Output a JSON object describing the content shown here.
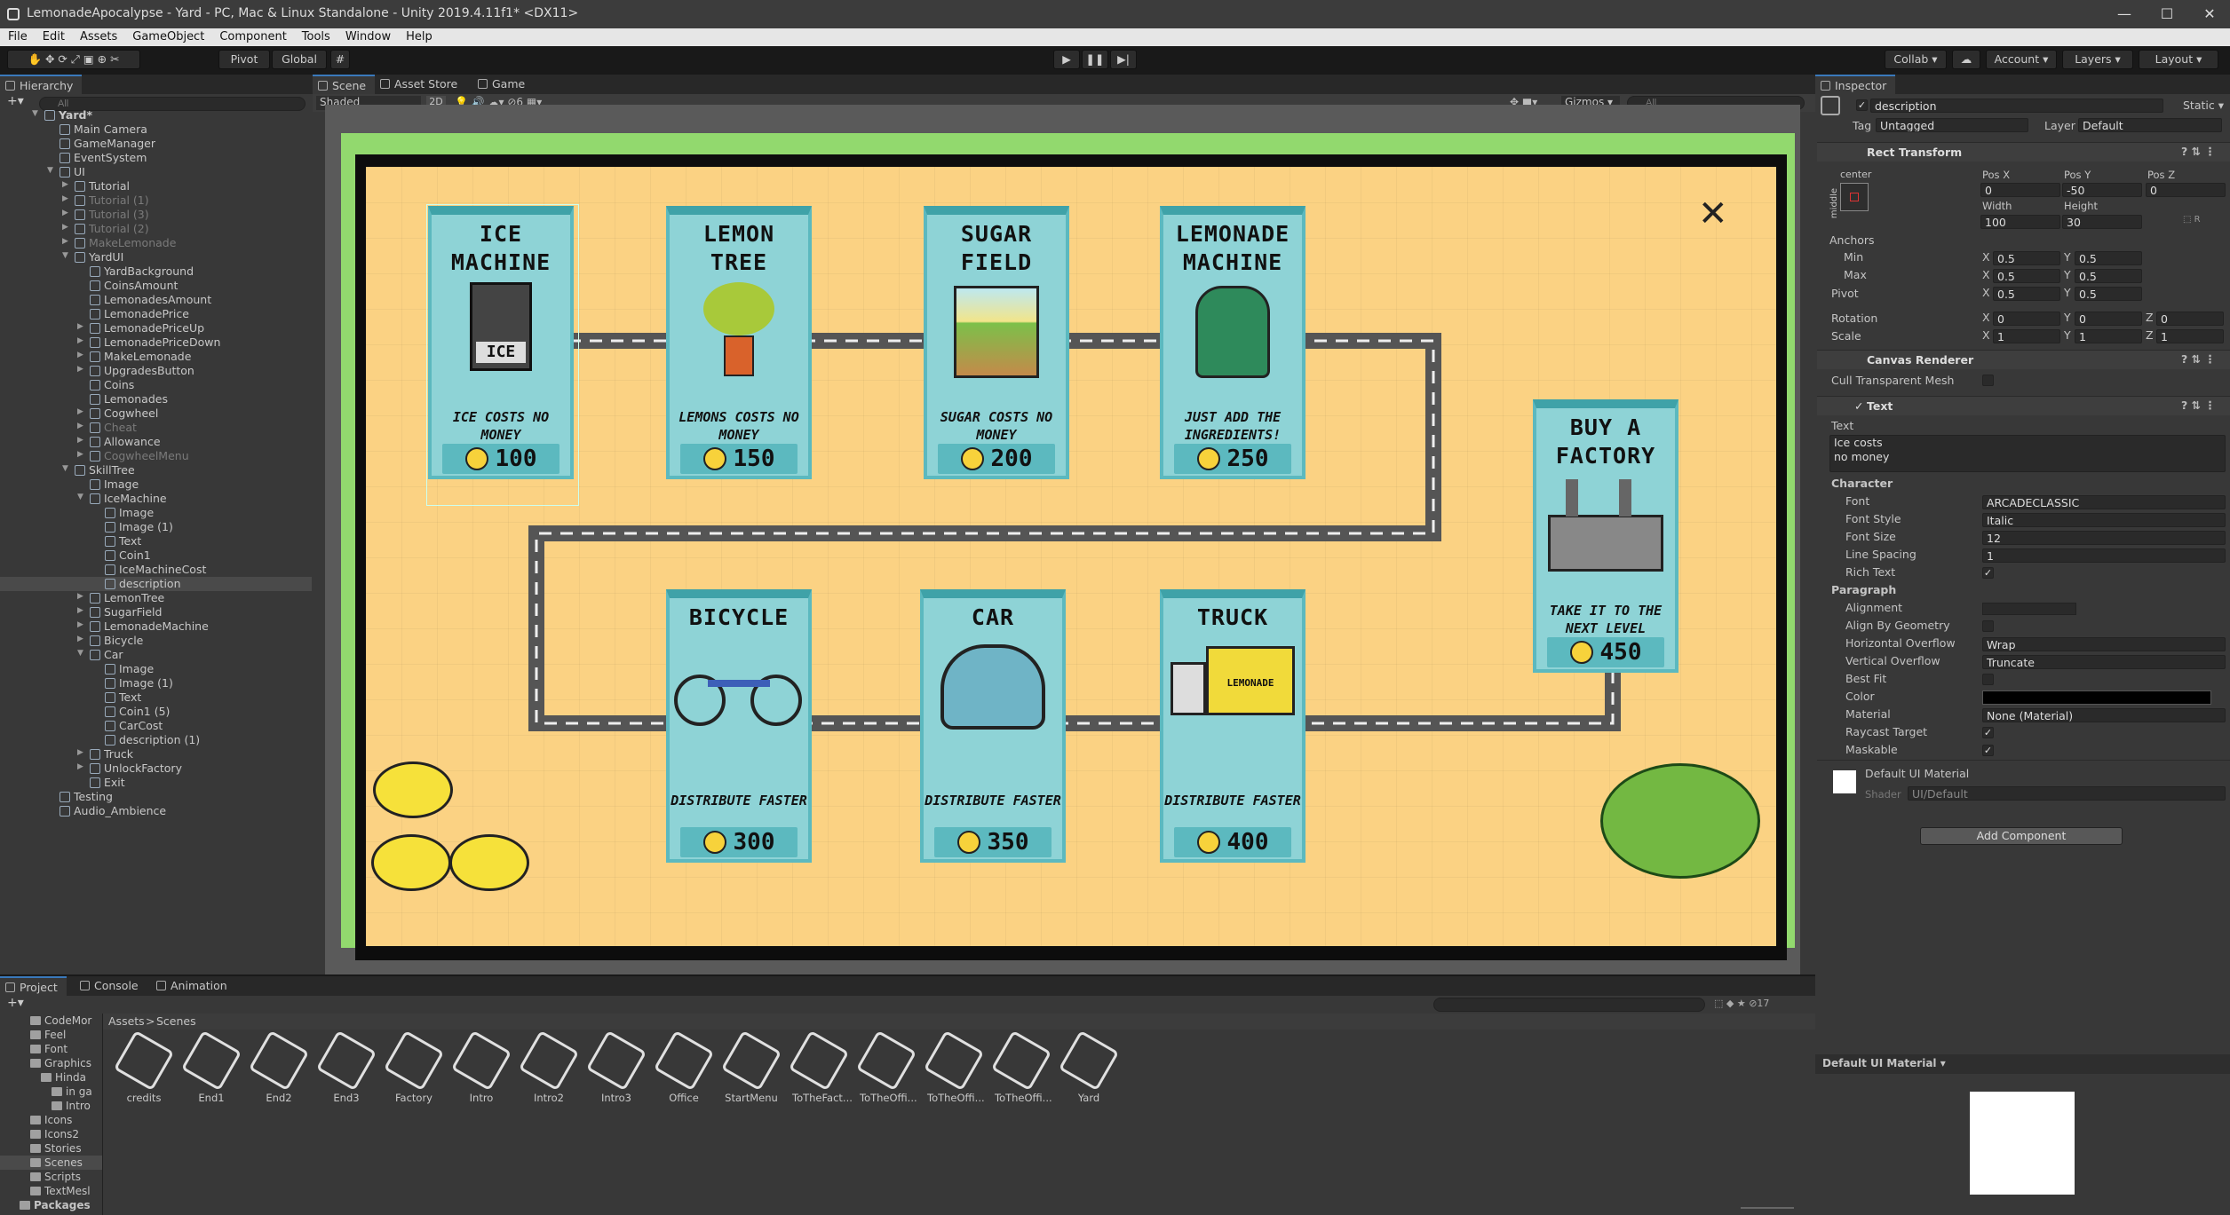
{
  "window": {
    "title": "LemonadeApocalypse - Yard - PC, Mac & Linux Standalone - Unity 2019.4.11f1* <DX11>"
  },
  "menu": [
    "File",
    "Edit",
    "Assets",
    "GameObject",
    "Component",
    "Tools",
    "Window",
    "Help"
  ],
  "toolbar": {
    "pivot": "Pivot",
    "global": "Global",
    "collab": "Collab ▾",
    "account": "Account ▾",
    "layers": "Layers ▾",
    "layout": "Layout ▾"
  },
  "hierarchy": {
    "title": "Hierarchy",
    "search_placeholder": "All",
    "rows": [
      {
        "label": "Yard*",
        "depth": 0,
        "arrow": "▼",
        "bold": true
      },
      {
        "label": "Main Camera",
        "depth": 1,
        "arrow": ""
      },
      {
        "label": "GameManager",
        "depth": 1,
        "arrow": ""
      },
      {
        "label": "EventSystem",
        "depth": 1,
        "arrow": ""
      },
      {
        "label": "UI",
        "depth": 1,
        "arrow": "▼"
      },
      {
        "label": "Tutorial",
        "depth": 2,
        "arrow": "▶"
      },
      {
        "label": "Tutorial (1)",
        "depth": 2,
        "arrow": "▶",
        "dim": true
      },
      {
        "label": "Tutorial (3)",
        "depth": 2,
        "arrow": "▶",
        "dim": true
      },
      {
        "label": "Tutorial (2)",
        "depth": 2,
        "arrow": "▶",
        "dim": true
      },
      {
        "label": "MakeLemonade",
        "depth": 2,
        "arrow": "▶",
        "dim": true
      },
      {
        "label": "YardUI",
        "depth": 2,
        "arrow": "▼"
      },
      {
        "label": "YardBackground",
        "depth": 3,
        "arrow": ""
      },
      {
        "label": "CoinsAmount",
        "depth": 3,
        "arrow": ""
      },
      {
        "label": "LemonadesAmount",
        "depth": 3,
        "arrow": ""
      },
      {
        "label": "LemonadePrice",
        "depth": 3,
        "arrow": ""
      },
      {
        "label": "LemonadePriceUp",
        "depth": 3,
        "arrow": "▶"
      },
      {
        "label": "LemonadePriceDown",
        "depth": 3,
        "arrow": "▶"
      },
      {
        "label": "MakeLemonade",
        "depth": 3,
        "arrow": "▶"
      },
      {
        "label": "UpgradesButton",
        "depth": 3,
        "arrow": "▶"
      },
      {
        "label": "Coins",
        "depth": 3,
        "arrow": ""
      },
      {
        "label": "Lemonades",
        "depth": 3,
        "arrow": ""
      },
      {
        "label": "Cogwheel",
        "depth": 3,
        "arrow": "▶"
      },
      {
        "label": "Cheat",
        "depth": 3,
        "arrow": "▶",
        "dim": true
      },
      {
        "label": "Allowance",
        "depth": 3,
        "arrow": "▶"
      },
      {
        "label": "CogwheelMenu",
        "depth": 3,
        "arrow": "▶",
        "dim": true
      },
      {
        "label": "SkillTree",
        "depth": 2,
        "arrow": "▼"
      },
      {
        "label": "Image",
        "depth": 3,
        "arrow": ""
      },
      {
        "label": "IceMachine",
        "depth": 3,
        "arrow": "▼"
      },
      {
        "label": "Image",
        "depth": 4,
        "arrow": ""
      },
      {
        "label": "Image (1)",
        "depth": 4,
        "arrow": ""
      },
      {
        "label": "Text",
        "depth": 4,
        "arrow": ""
      },
      {
        "label": "Coin1",
        "depth": 4,
        "arrow": ""
      },
      {
        "label": "IceMachineCost",
        "depth": 4,
        "arrow": ""
      },
      {
        "label": "description",
        "depth": 4,
        "arrow": "",
        "selected": true
      },
      {
        "label": "LemonTree",
        "depth": 3,
        "arrow": "▶"
      },
      {
        "label": "SugarField",
        "depth": 3,
        "arrow": "▶"
      },
      {
        "label": "LemonadeMachine",
        "depth": 3,
        "arrow": "▶"
      },
      {
        "label": "Bicycle",
        "depth": 3,
        "arrow": "▶"
      },
      {
        "label": "Car",
        "depth": 3,
        "arrow": "▼"
      },
      {
        "label": "Image",
        "depth": 4,
        "arrow": ""
      },
      {
        "label": "Image (1)",
        "depth": 4,
        "arrow": ""
      },
      {
        "label": "Text",
        "depth": 4,
        "arrow": ""
      },
      {
        "label": "Coin1 (5)",
        "depth": 4,
        "arrow": ""
      },
      {
        "label": "CarCost",
        "depth": 4,
        "arrow": ""
      },
      {
        "label": "description (1)",
        "depth": 4,
        "arrow": ""
      },
      {
        "label": "Truck",
        "depth": 3,
        "arrow": "▶"
      },
      {
        "label": "UnlockFactory",
        "depth": 3,
        "arrow": "▶"
      },
      {
        "label": "Exit",
        "depth": 3,
        "arrow": ""
      },
      {
        "label": "Testing",
        "depth": 1,
        "arrow": ""
      },
      {
        "label": "Audio_Ambience",
        "depth": 1,
        "arrow": ""
      }
    ]
  },
  "scene_tabs": [
    "Scene",
    "Asset Store",
    "Game"
  ],
  "scene_toolbar": {
    "shading": "Shaded",
    "mode2d": "2D",
    "gizmos": "Gizmos ▾",
    "search": "All",
    "hidden": "6"
  },
  "game": {
    "close": "✕",
    "cards": [
      {
        "title": "ICE MACHINE",
        "desc": "ICE COSTS NO MONEY",
        "price": "100"
      },
      {
        "title": "LEMON TREE",
        "desc": "LEMONS COSTS NO MONEY",
        "price": "150"
      },
      {
        "title": "SUGAR FIELD",
        "desc": "SUGAR COSTS NO MONEY",
        "price": "200"
      },
      {
        "title": "LEMONADE MACHINE",
        "desc": "JUST ADD THE INGREDIENTS!",
        "price": "250"
      },
      {
        "title": "BUY A FACTORY",
        "desc": "TAKE IT TO THE NEXT LEVEL",
        "price": "450"
      },
      {
        "title": "BICYCLE",
        "desc": "DISTRIBUTE FASTER",
        "price": "300"
      },
      {
        "title": "CAR",
        "desc": "DISTRIBUTE FASTER",
        "price": "350"
      },
      {
        "title": "TRUCK",
        "desc": "DISTRIBUTE FASTER",
        "price": "400"
      }
    ],
    "ice_label": "ICE",
    "truck_label": "LEMONADE"
  },
  "inspector": {
    "title": "Inspector",
    "object_name": "description",
    "static": "Static ▾",
    "tag_label": "Tag",
    "tag": "Untagged",
    "layer_label": "Layer",
    "layer": "Default",
    "rect": {
      "title": "Rect Transform",
      "anchor_label": "center",
      "side_label": "middle",
      "posx_label": "Pos X",
      "posy_label": "Pos Y",
      "posz_label": "Pos Z",
      "posx": "0",
      "posy": "-50",
      "posz": "0",
      "w_label": "Width",
      "h_label": "Height",
      "w": "100",
      "h": "30",
      "anchors": "Anchors",
      "min": "Min",
      "max": "Max",
      "pivot": "Pivot",
      "rotation": "Rotation",
      "scale": "Scale",
      "x": "X",
      "y": "Y",
      "z": "Z",
      "v05": "0.5",
      "v0": "0",
      "v1": "1"
    },
    "canvas_renderer": "Canvas Renderer",
    "cull": "Cull Transparent Mesh",
    "text": {
      "title": "Text",
      "text_label": "Text",
      "text_value1": "Ice costs",
      "text_value2": "no money",
      "character": "Character",
      "font_label": "Font",
      "font": "ARCADECLASSIC",
      "style_label": "Font Style",
      "style": "Italic",
      "size_label": "Font Size",
      "size": "12",
      "spacing_label": "Line Spacing",
      "spacing": "1",
      "rich_label": "Rich Text",
      "paragraph": "Paragraph",
      "align_label": "Alignment",
      "geom_label": "Align By Geometry",
      "hover_label": "Horizontal Overflow",
      "hover": "Wrap",
      "vover_label": "Vertical Overflow",
      "vover": "Truncate",
      "best_label": "Best Fit",
      "color_label": "Color",
      "material_label": "Material",
      "material": "None (Material)",
      "raycast_label": "Raycast Target",
      "maskable_label": "Maskable"
    },
    "material": {
      "name": "Default UI Material",
      "shader_label": "Shader",
      "shader": "UI/Default"
    },
    "add_component": "Add Component",
    "preview_label": "Default UI Material ▾"
  },
  "project": {
    "tabs": [
      "Project",
      "Console",
      "Animation"
    ],
    "breadcrumb": [
      "Assets",
      ">",
      "Scenes"
    ],
    "count": "17",
    "tree": [
      {
        "label": "CodeMor",
        "depth": 1
      },
      {
        "label": "Feel",
        "depth": 1
      },
      {
        "label": "Font",
        "depth": 1
      },
      {
        "label": "Graphics",
        "depth": 1
      },
      {
        "label": "Hinda",
        "depth": 2
      },
      {
        "label": "in ga",
        "depth": 3
      },
      {
        "label": "Intro",
        "depth": 3
      },
      {
        "label": "Icons",
        "depth": 1
      },
      {
        "label": "Icons2",
        "depth": 1
      },
      {
        "label": "Stories",
        "depth": 1
      },
      {
        "label": "Scenes",
        "depth": 1,
        "selected": true
      },
      {
        "label": "Scripts",
        "depth": 1
      },
      {
        "label": "TextMesl",
        "depth": 1
      },
      {
        "label": "Packages",
        "depth": 0
      }
    ],
    "assets": [
      "credits",
      "End1",
      "End2",
      "End3",
      "Factory",
      "Intro",
      "Intro2",
      "Intro3",
      "Office",
      "StartMenu",
      "ToTheFact...",
      "ToTheOffi...",
      "ToTheOffi...",
      "ToTheOffi...",
      "Yard"
    ]
  },
  "colors": {
    "accent": "#3a79bb",
    "game_bg": "#fbd283",
    "road": "#555555",
    "card": "#8ed3d6"
  }
}
